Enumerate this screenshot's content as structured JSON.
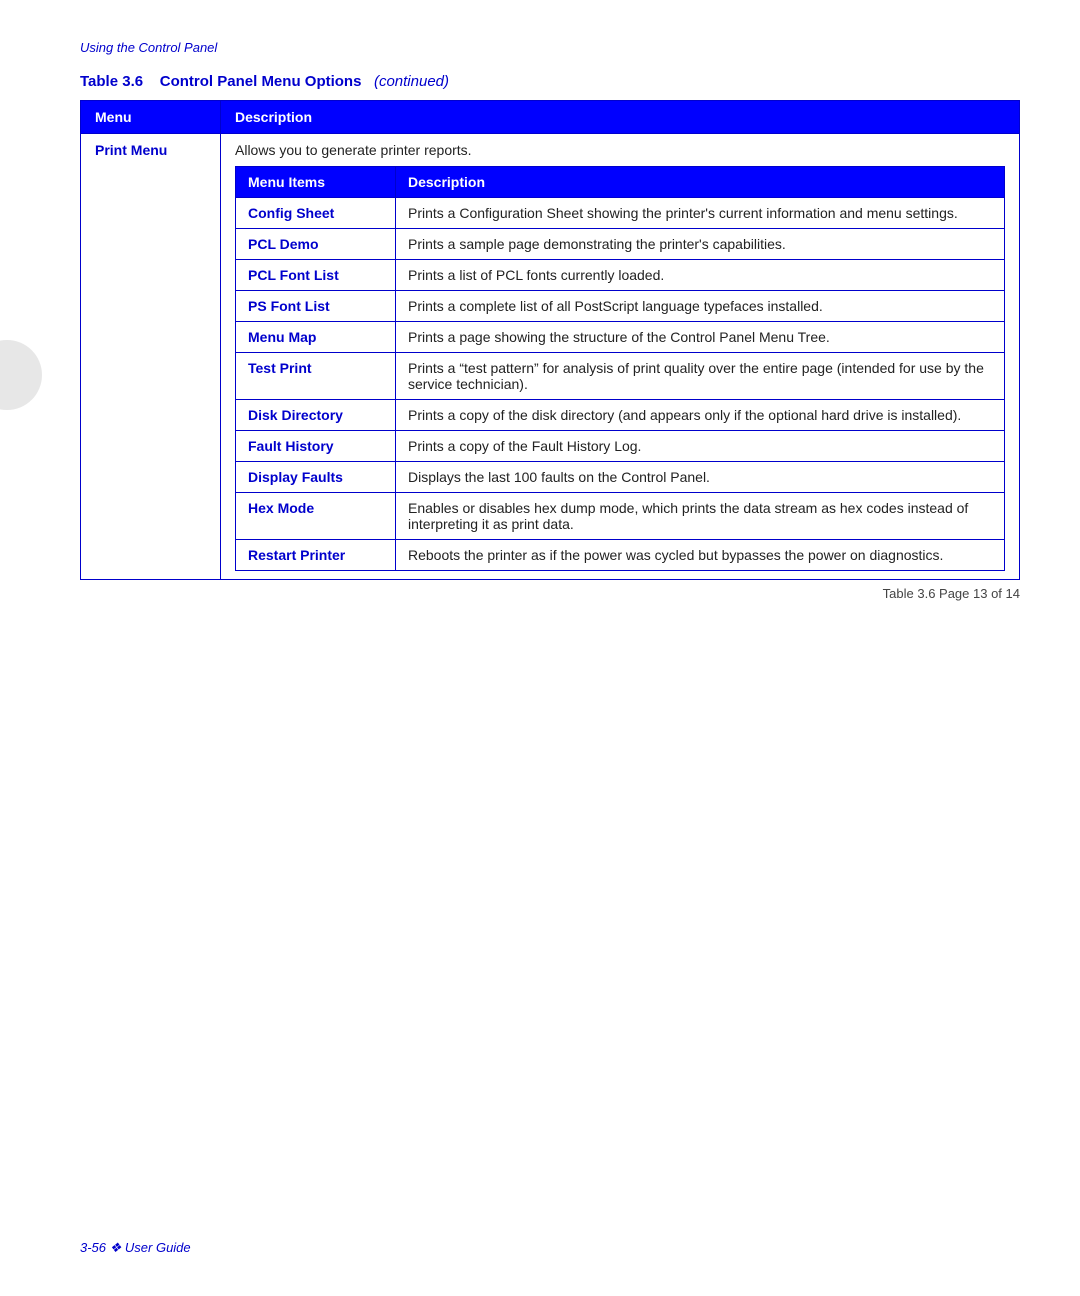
{
  "header": {
    "breadcrumb": "Using the Control Panel"
  },
  "table_title": {
    "label": "Table 3.6",
    "name": "Control Panel Menu Options",
    "continued": "(continued)"
  },
  "main_columns": {
    "menu": "Menu",
    "description": "Description"
  },
  "print_menu": {
    "label": "Print Menu",
    "intro": "Allows you to generate printer reports.",
    "inner_columns": {
      "menu_items": "Menu Items",
      "description": "Description"
    },
    "items": [
      {
        "name": "Config Sheet",
        "description": "Prints a Configuration Sheet showing the printer's current information and menu settings."
      },
      {
        "name": "PCL Demo",
        "description": "Prints a sample page demonstrating the printer's capabilities."
      },
      {
        "name": "PCL Font List",
        "description": "Prints a list of PCL fonts currently loaded."
      },
      {
        "name": "PS Font List",
        "description": "Prints a complete list of all PostScript language typefaces installed."
      },
      {
        "name": "Menu Map",
        "description": "Prints a page showing the structure of the Control Panel Menu Tree."
      },
      {
        "name": "Test Print",
        "description": "Prints a “test pattern” for analysis of print quality over the entire page (intended for use by the service technician)."
      },
      {
        "name": "Disk Directory",
        "description": "Prints a copy of the disk directory (and appears only if the optional hard drive is installed)."
      },
      {
        "name": "Fault History",
        "description": "Prints a copy of the Fault History Log."
      },
      {
        "name": "Display Faults",
        "description": "Displays the last 100 faults on the Control Panel."
      },
      {
        "name": "Hex Mode",
        "description": "Enables or disables hex dump mode, which prints the data stream as hex codes instead of interpreting it as print data."
      },
      {
        "name": "Restart Printer",
        "description": "Reboots the printer as if the power was cycled but bypasses the power on diagnostics."
      }
    ]
  },
  "footer_note": "Table 3.6  Page 13 of 14",
  "page_number": "3-56  ❖  User Guide"
}
